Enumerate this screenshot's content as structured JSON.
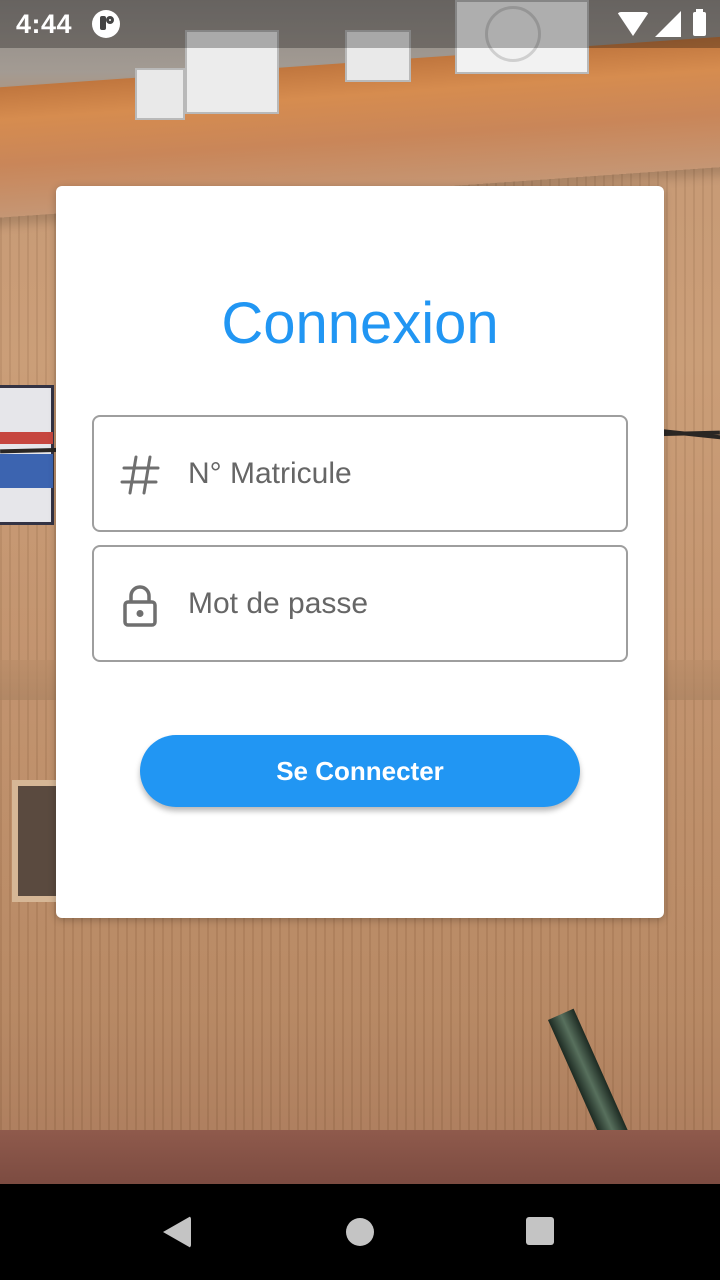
{
  "status_bar": {
    "time": "4:44",
    "icons": [
      "app-notification-icon",
      "wifi-icon",
      "signal-icon",
      "battery-icon"
    ]
  },
  "login": {
    "title": "Connexion",
    "matricule_placeholder": "N° Matricule",
    "matricule_icon": "hash-icon",
    "password_placeholder": "Mot de passe",
    "password_icon": "lock-icon",
    "button_label": "Se Connecter"
  },
  "nav_bar": {
    "buttons": [
      "back-icon",
      "home-icon",
      "recents-icon"
    ]
  },
  "colors": {
    "accent": "#2196f3",
    "card_background": "#ffffff",
    "field_border": "#9e9e9e",
    "nav_background": "#000000"
  }
}
